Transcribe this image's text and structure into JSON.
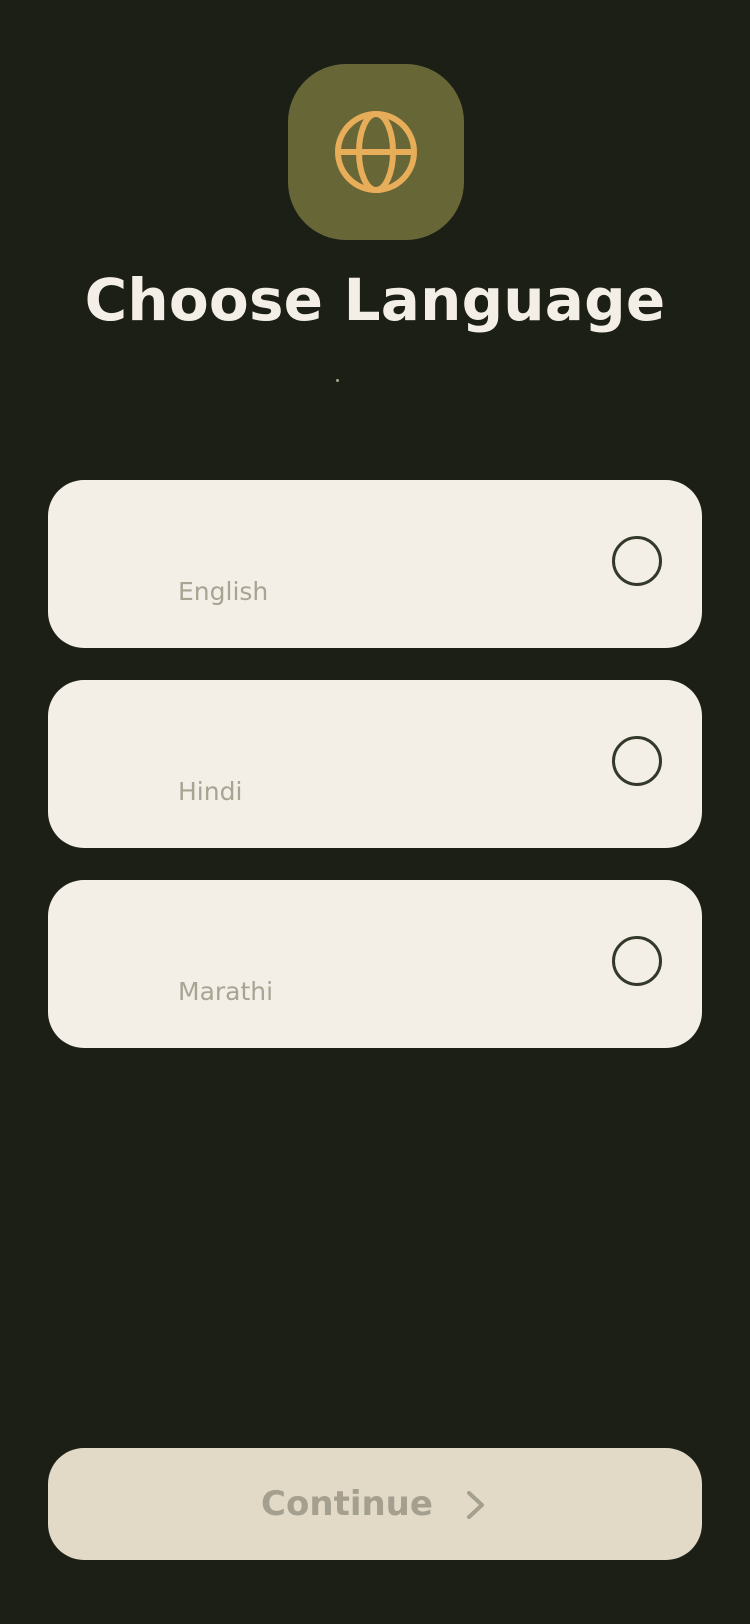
{
  "header": {
    "icon_name": "globe-icon",
    "title": "Choose Language"
  },
  "languages": [
    {
      "label": "English",
      "selected": false
    },
    {
      "label": "Hindi",
      "selected": false
    },
    {
      "label": "Marathi",
      "selected": false
    }
  ],
  "footer": {
    "continue_label": "Continue",
    "continue_icon": "chevron-right-icon"
  },
  "colors": {
    "background": "#1b1f16",
    "icon_tile": "#676637",
    "icon_accent": "#e8ad58",
    "card": "#f3efe6",
    "continue_button": "#e2dac6"
  }
}
